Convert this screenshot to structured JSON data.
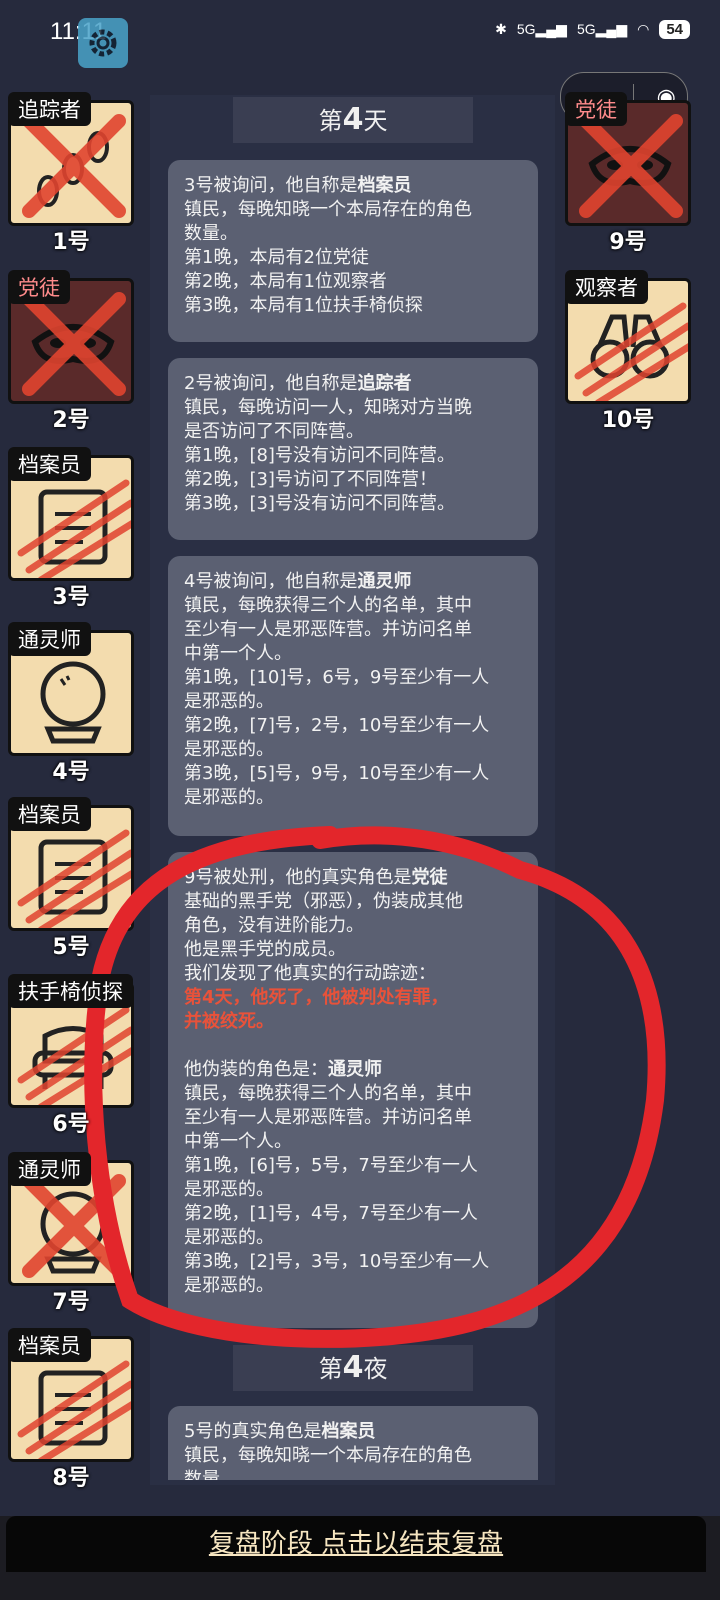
{
  "status": {
    "time": "11:11",
    "signal1": "5G",
    "signal2": "5G",
    "battery": "54"
  },
  "capsule": {
    "more": "•••",
    "close": "◉"
  },
  "players_left": [
    {
      "role": "追踪者",
      "num": "1号",
      "evil": false,
      "icon": "footprints-icon",
      "status": "dead-cross"
    },
    {
      "role": "党徒",
      "num": "2号",
      "evil": true,
      "icon": "mask-icon",
      "status": "dead-cross"
    },
    {
      "role": "档案员",
      "num": "3号",
      "evil": false,
      "icon": "scroll-icon",
      "status": "clawed"
    },
    {
      "role": "通灵师",
      "num": "4号",
      "evil": false,
      "icon": "crystal-ball-icon",
      "status": "alive"
    },
    {
      "role": "档案员",
      "num": "5号",
      "evil": false,
      "icon": "scroll-icon",
      "status": "clawed"
    },
    {
      "role": "扶手椅侦探",
      "num": "6号",
      "evil": false,
      "icon": "armchair-icon",
      "status": "clawed"
    },
    {
      "role": "通灵师",
      "num": "7号",
      "evil": false,
      "icon": "crystal-ball-icon",
      "status": "dead-cross"
    },
    {
      "role": "档案员",
      "num": "8号",
      "evil": false,
      "icon": "scroll-icon",
      "status": "clawed"
    }
  ],
  "players_right": [
    {
      "role": "党徒",
      "num": "9号",
      "evil": true,
      "icon": "mask-icon",
      "status": "dead-cross"
    },
    {
      "role": "观察者",
      "num": "10号",
      "evil": false,
      "icon": "binoculars-icon",
      "status": "clawed"
    }
  ],
  "log": {
    "day_prefix": "第",
    "day_number": "4",
    "day_suffix": "天",
    "night_prefix": "第",
    "night_number": "4",
    "night_suffix": "夜",
    "msg1": {
      "lead": "3号被询问，他自称是",
      "role": "档案员",
      "lines": [
        "镇民，每晚知晓一个本局存在的角色",
        "数量。",
        "第1晚，本局有2位党徒",
        "第2晚，本局有1位观察者",
        "第3晚，本局有1位扶手椅侦探"
      ]
    },
    "msg2": {
      "lead": "2号被询问，他自称是",
      "role": "追踪者",
      "lines": [
        "镇民，每晚访问一人，知晓对方当晚",
        "是否访问了不同阵营。",
        "第1晚，[8]号没有访问不同阵营。",
        "第2晚，[3]号访问了不同阵营！",
        "第3晚，[3]号没有访问不同阵营。"
      ]
    },
    "msg3": {
      "lead": "4号被询问，他自称是",
      "role": "通灵师",
      "lines": [
        "镇民，每晚获得三个人的名单，其中",
        "至少有一人是邪恶阵营。并访问名单",
        "中第一个人。",
        "第1晚，[10]号，6号，9号至少有一人",
        "是邪恶的。",
        "第2晚，[7]号，2号，10号至少有一人",
        "是邪恶的。",
        "第3晚，[5]号，9号，10号至少有一人",
        "是邪恶的。"
      ]
    },
    "msg4": {
      "lead": "9号被处刑，他的真实角色是",
      "role": "党徒",
      "lines_a": [
        "基础的黑手党（邪恶），伪装成其他",
        "角色，没有进阶能力。",
        "他是黑手党的成员。",
        "我们发现了他真实的行动踪迹："
      ],
      "red_lines": [
        "第4天，他死了，他被判处有罪，",
        "并被绞死。"
      ],
      "disguise_lead": "他伪装的角色是：",
      "disguise_role": "通灵师",
      "lines_b": [
        "镇民，每晚获得三个人的名单，其中",
        "至少有一人是邪恶阵营。并访问名单",
        "中第一个人。",
        "第1晚，[6]号，5号，7号至少有一人",
        "是邪恶的。",
        "第2晚，[1]号，4号，7号至少有一人",
        "是邪恶的。",
        "第3晚，[2]号，3号，10号至少有一人",
        "是邪恶的。"
      ]
    },
    "msg5": {
      "lead": "5号的真实角色是",
      "role": "档案员",
      "lines": [
        "镇民，每晚知晓一个本局存在的角色",
        "数量"
      ]
    }
  },
  "end_button": "复盘阶段 点击以结束复盘",
  "colors": {
    "background": "#262a3d",
    "message": "#5b6072",
    "red_text": "#e8523a",
    "annotation": "#e3262b",
    "card": "#f3dcae"
  }
}
